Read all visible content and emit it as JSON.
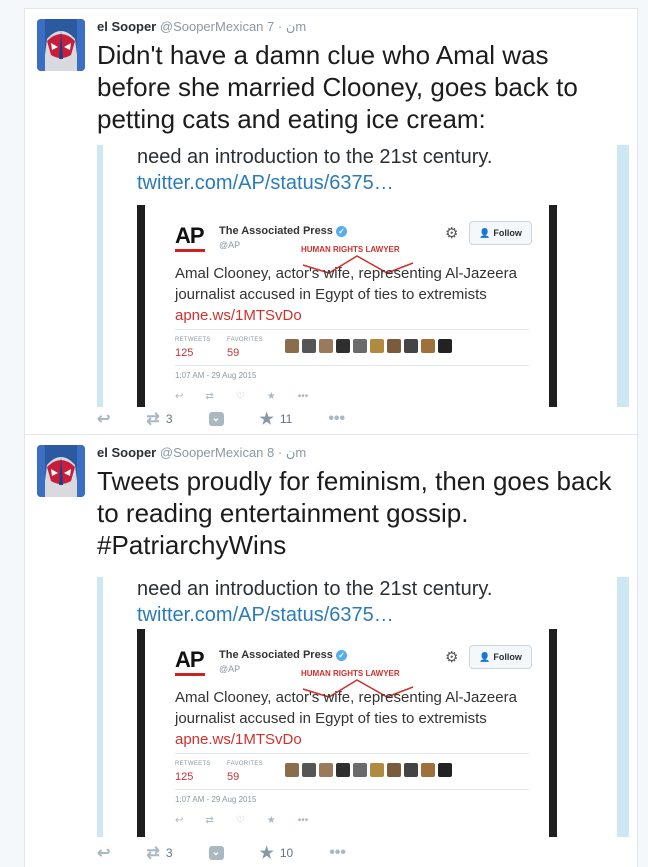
{
  "tweets": [
    {
      "author": {
        "name": "el Sooper",
        "handle": "@SooperMexican",
        "mark": "ن",
        "time": "7m"
      },
      "text": "Didn't have a damn clue who Amal was before she married Clooney, goes back to petting cats and eating ice cream:",
      "quote": {
        "line1": "need an introduction to the 21st century.",
        "line2": "twitter.com/AP/status/6375…",
        "embedded": {
          "logo": "AP",
          "name": "The Associated Press",
          "verified_mark": "✓",
          "handle": "@AP",
          "follow": "Follow",
          "annotation": "HUMAN RIGHTS LAWYER",
          "text_before": "Amal Clooney, actor's wife, representing Al-Jazeera journalist accused in Egypt of ties to extremists ",
          "link": "apne.ws/1MTSvDo",
          "retweets_label": "RETWEETS",
          "retweets": "125",
          "favorites_label": "FAVORITES",
          "favorites": "59",
          "timestamp": "1:07 AM - 29 Aug 2015"
        }
      },
      "actions": {
        "retweets": "3",
        "favorites": "11"
      }
    },
    {
      "author": {
        "name": "el Sooper",
        "handle": "@SooperMexican",
        "mark": "ن",
        "time": "8m"
      },
      "text": "Tweets proudly for feminism, then goes back to reading entertainment gossip. #PatriarchyWins",
      "quote": {
        "line1": "need an introduction to the 21st century.",
        "line2": "twitter.com/AP/status/6375…",
        "embedded": {
          "logo": "AP",
          "name": "The Associated Press",
          "verified_mark": "✓",
          "handle": "@AP",
          "follow": "Follow",
          "annotation": "HUMAN RIGHTS LAWYER",
          "text_before": "Amal Clooney, actor's wife, representing Al-Jazeera journalist accused in Egypt of ties to extremists ",
          "link": "apne.ws/1MTSvDo",
          "retweets_label": "RETWEETS",
          "retweets": "125",
          "favorites_label": "FAVORITES",
          "favorites": "59",
          "timestamp": "1:07 AM - 29 Aug 2015"
        }
      },
      "actions": {
        "retweets": "3",
        "favorites": "10"
      }
    }
  ],
  "icons": {
    "reply": "reply-icon",
    "retweet": "retweet-icon",
    "pocket": "pocket-icon",
    "favorite": "star-icon",
    "more": "more-icon",
    "gear": "gear-icon"
  },
  "colors": {
    "link": "#2b7bb9",
    "quote_bar": "#cde7f5",
    "ap_red": "#d0312d"
  }
}
